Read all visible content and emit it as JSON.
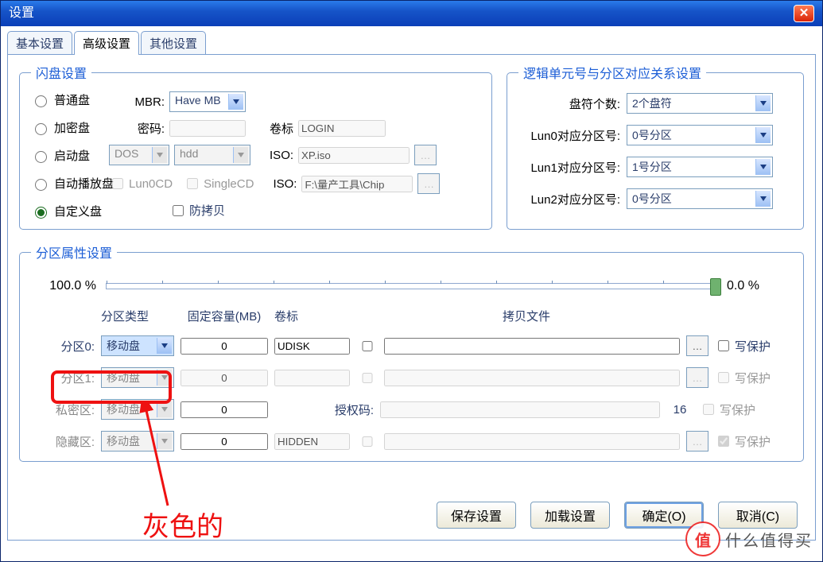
{
  "window": {
    "title": "设置"
  },
  "tabs": {
    "t0": "基本设置",
    "t1": "高级设置",
    "t2": "其他设置",
    "active": 1
  },
  "flash": {
    "legend": "闪盘设置",
    "radios": {
      "r0": "普通盘",
      "r1": "加密盘",
      "r2": "启动盘",
      "r3": "自动播放盘",
      "r4": "自定义盘",
      "selected": 4
    },
    "mbr_label": "MBR:",
    "mbr_value": "Have MB",
    "pwd_label": "密码:",
    "pwd_value": "",
    "vol_label": "卷标",
    "vol_value": "LOGIN",
    "dos_value": "DOS",
    "hdd_value": "hdd",
    "iso1_label": "ISO:",
    "iso1_value": "XP.iso",
    "lun0cd_label": "Lun0CD",
    "singlecd_label": "SingleCD",
    "iso2_label": "ISO:",
    "iso2_value": "F:\\量产工具\\Chip",
    "anticopy_label": "防拷贝"
  },
  "lun": {
    "legend": "逻辑单元号与分区对应关系设置",
    "count_label": "盘符个数:",
    "count_value": "2个盘符",
    "l0_label": "Lun0对应分区号:",
    "l0_value": "0号分区",
    "l1_label": "Lun1对应分区号:",
    "l1_value": "1号分区",
    "l2_label": "Lun2对应分区号:",
    "l2_value": "0号分区"
  },
  "part": {
    "legend": "分区属性设置",
    "slider_left": "100.0 %",
    "slider_right": "0.0 %",
    "head_type": "分区类型",
    "head_cap": "固定容量(MB)",
    "head_vol": "卷标",
    "head_file": "拷贝文件",
    "wp_label": "写保护",
    "p0_label": "分区0:",
    "p0_type": "移动盘",
    "p0_cap": "0",
    "p0_vol": "UDISK",
    "p1_label": "分区1:",
    "p1_type": "移动盘",
    "p1_cap": "0",
    "p1_vol": "",
    "pv_label": "私密区:",
    "pv_type": "移动盘",
    "pv_cap": "0",
    "auth_label": "授权码:",
    "auth_value": "",
    "auth_limit": "16",
    "hd_label": "隐藏区:",
    "hd_type": "移动盘",
    "hd_cap": "0",
    "hd_vol": "HIDDEN"
  },
  "buttons": {
    "save": "保存设置",
    "load": "加载设置",
    "ok": "确定(O)",
    "cancel": "取消(C)"
  },
  "annotation": "灰色的",
  "watermark": {
    "char": "值",
    "text": "什么值得买"
  }
}
